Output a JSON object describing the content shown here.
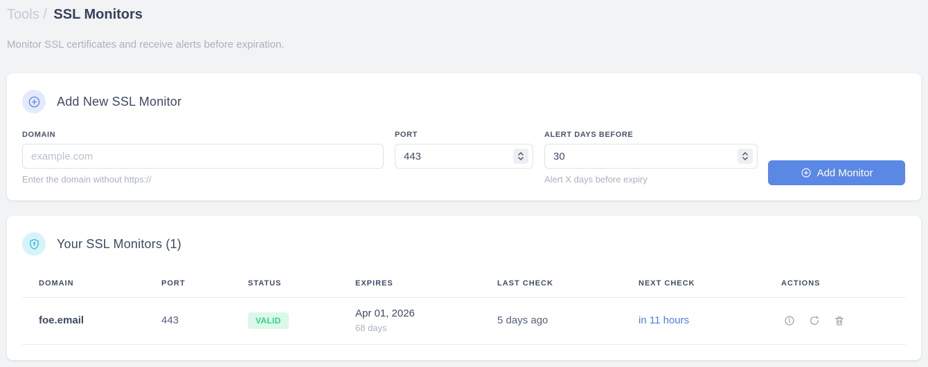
{
  "page": {
    "breadcrumb": {
      "parent": "Tools",
      "separator": "/",
      "current": "SSL Monitors"
    },
    "subtitle": "Monitor SSL certificates and receive alerts before expiration."
  },
  "add_monitor_card": {
    "title": "Add New SSL Monitor",
    "fields": {
      "domain": {
        "label": "DOMAIN",
        "placeholder": "example.com",
        "helper": "Enter the domain without https://"
      },
      "port": {
        "label": "PORT",
        "value": "443"
      },
      "alert_days": {
        "label": "ALERT DAYS BEFORE",
        "value": "30",
        "helper": "Alert X days before expiry"
      }
    },
    "submit_label": "Add Monitor"
  },
  "monitors_card": {
    "title": "Your SSL Monitors (1)",
    "table": {
      "headers": [
        "DOMAIN",
        "PORT",
        "STATUS",
        "EXPIRES",
        "LAST CHECK",
        "NEXT CHECK",
        "ACTIONS"
      ],
      "rows": [
        {
          "domain": "foe.email",
          "port": "443",
          "status": "VALID",
          "expires_date": "Apr 01, 2026",
          "expires_days": "68 days",
          "last_check": "5 days ago",
          "next_check": "in 11 hours"
        }
      ]
    }
  },
  "colors": {
    "accent_blue": "#5b87e5",
    "link_blue": "#4a7cf6",
    "valid_text": "#31d382",
    "valid_bg": "#dcf8e9",
    "teal": "#2ac0da",
    "page_bg": "#f1f3f4"
  }
}
